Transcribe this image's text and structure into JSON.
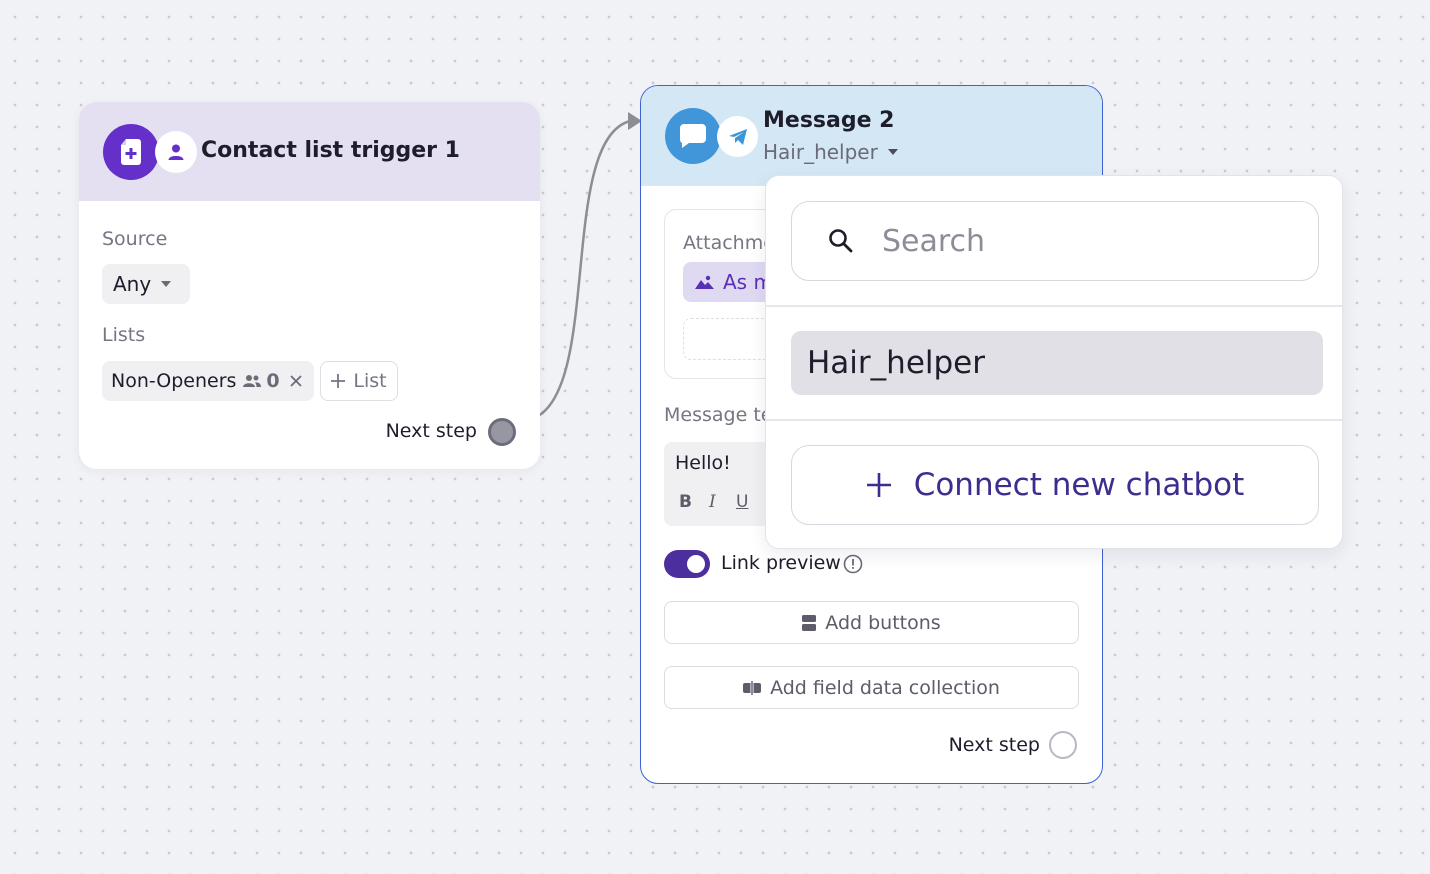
{
  "trigger_node": {
    "title": "Contact list trigger 1",
    "source_label": "Source",
    "source_value": "Any",
    "lists_label": "Lists",
    "list_chip": {
      "name": "Non-Openers",
      "count": "0"
    },
    "add_list_label": "List",
    "next_step_label": "Next step"
  },
  "message_node": {
    "title": "Message 2",
    "bot_name": "Hair_helper",
    "attachment_label": "Attachme",
    "attachment_chip": "As m",
    "message_text_label": "Message te",
    "message_text": "Hello!",
    "format_bold": "B",
    "format_italic": "I",
    "format_underline": "U",
    "link_preview_label": "Link preview",
    "link_preview_enabled": true,
    "add_buttons_label": "Add buttons",
    "add_field_label": "Add field data collection",
    "next_step_label": "Next step"
  },
  "bot_dropdown": {
    "search_placeholder": "Search",
    "options": [
      "Hair_helper"
    ],
    "connect_label": "Connect new chatbot"
  },
  "colors": {
    "trigger_accent": "#6530c9",
    "message_accent": "#4096d8",
    "selected_border": "#3f61d6",
    "toggle_on": "#4d2e9e",
    "connect_text": "#3e2d8f"
  },
  "icons": {
    "trigger_main": "contact-list-icon",
    "trigger_small": "person-icon",
    "message_main": "chat-bubble-icon",
    "message_small": "telegram-icon",
    "search": "search-icon",
    "plus": "plus-icon"
  }
}
